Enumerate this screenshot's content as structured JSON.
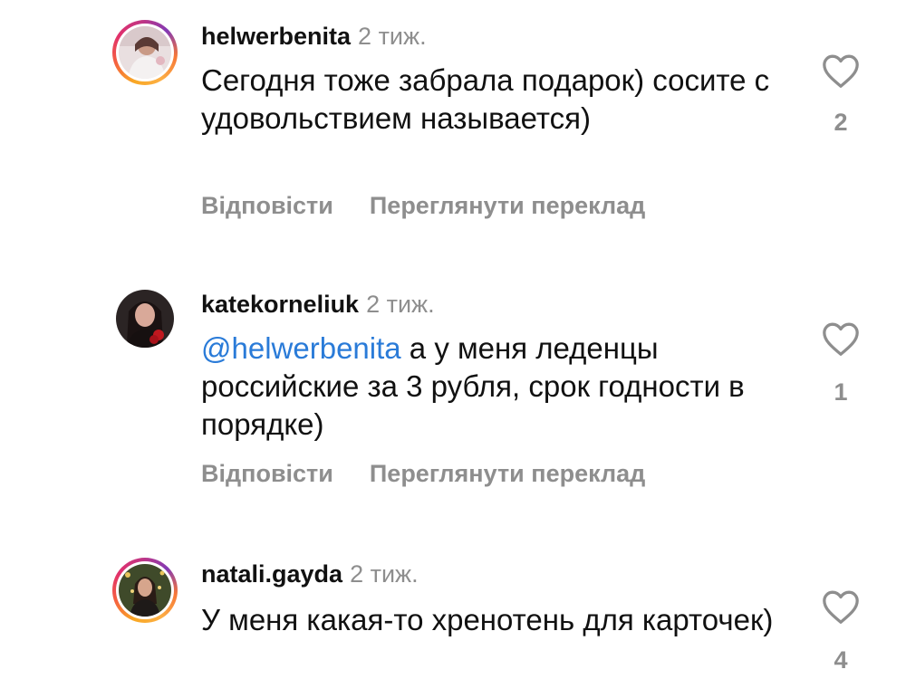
{
  "comments": [
    {
      "username": "helwerbenita",
      "time": "2 тиж.",
      "mention": "",
      "text": "Сегодня тоже забрала подарок) сосите с удовольствием называется)",
      "reply_label": "Відповісти",
      "translate_label": "Переглянути переклад",
      "likes": "2",
      "story_ring": true
    },
    {
      "username": "katekorneliuk",
      "time": "2 тиж.",
      "mention": "@helwerbenita",
      "text": "а у меня леденцы российские за 3 рубля, срок годности в порядке)",
      "reply_label": "Відповісти",
      "translate_label": "Переглянути переклад",
      "likes": "1",
      "story_ring": false
    },
    {
      "username": "natali.gayda",
      "time": "2 тиж.",
      "mention": "",
      "text": "У меня какая-то хренотень для карточек)",
      "likes": "4",
      "story_ring": true
    }
  ],
  "colors": {
    "mention": "#2a7bd8",
    "secondary_text": "#8e8e8e",
    "primary_text": "#111111"
  },
  "icons": {
    "like": "heart-outline-icon"
  }
}
